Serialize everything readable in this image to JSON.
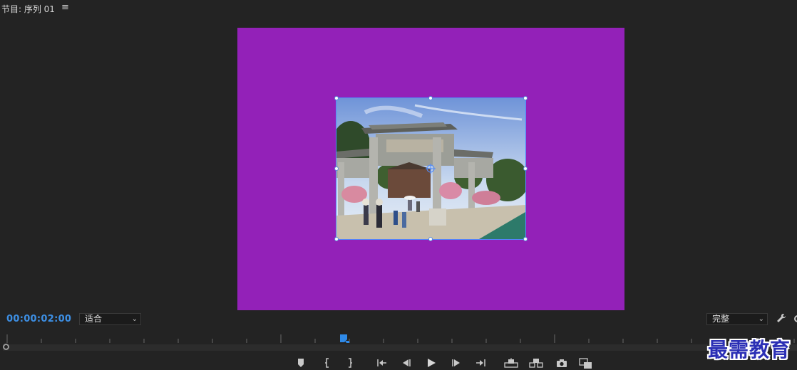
{
  "header": {
    "title": "节目: 序列 01",
    "menu_icon": "hamburger-menu-icon"
  },
  "monitor": {
    "background_color": "#9321b8",
    "clip_description_icon": "image-thumbnail",
    "selection_color": "#4f8cff"
  },
  "toolbar": {
    "timecode": "00:00:02:00",
    "timecode_color": "#3d8fe4",
    "fit_select": {
      "value": "适合"
    },
    "resolution_select": {
      "value": "完整"
    },
    "settings_icon": "wrench-icon"
  },
  "timeline": {
    "playhead_icon": "playhead-icon",
    "scroll_handle_icon": "circle-icon"
  },
  "transport": [
    {
      "name": "add-marker-button",
      "icon": "marker-icon"
    },
    {
      "name": "mark-in-button",
      "icon": "mark-in-icon"
    },
    {
      "name": "mark-out-button",
      "icon": "mark-out-icon"
    },
    {
      "name": "go-to-in-button",
      "icon": "go-to-in-icon"
    },
    {
      "name": "step-back-button",
      "icon": "step-back-icon"
    },
    {
      "name": "play-button",
      "icon": "play-icon"
    },
    {
      "name": "step-forward-button",
      "icon": "step-forward-icon"
    },
    {
      "name": "go-to-out-button",
      "icon": "go-to-out-icon"
    },
    {
      "name": "lift-button",
      "icon": "lift-icon"
    },
    {
      "name": "extract-button",
      "icon": "extract-icon"
    },
    {
      "name": "export-frame-button",
      "icon": "camera-icon"
    },
    {
      "name": "comparison-view-button",
      "icon": "comparison-icon"
    }
  ],
  "watermark": {
    "text": "最需教育"
  }
}
